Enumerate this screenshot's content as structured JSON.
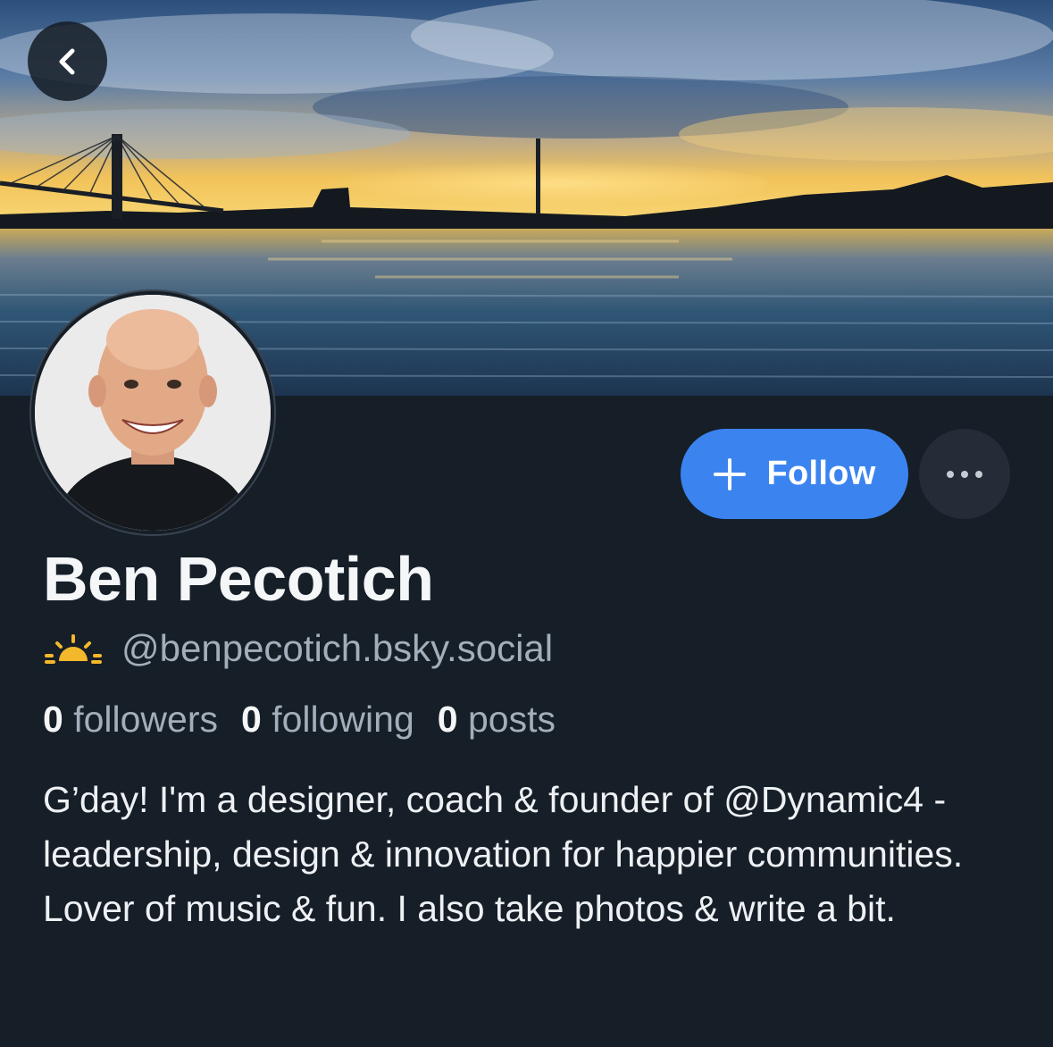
{
  "profile": {
    "display_name": "Ben Pecotich",
    "handle": "@benpecotich.bsky.social",
    "handle_emoji_icon": "sunrise-icon",
    "stats": [
      {
        "count": "0",
        "label": "followers"
      },
      {
        "count": "0",
        "label": "following"
      },
      {
        "count": "0",
        "label": "posts"
      }
    ],
    "bio": "G’day! I'm a designer, coach & founder of @Dynamic4 - leadership, design & innovation for happier communities. Lover of music & fun. I also take photos & write a bit."
  },
  "actions": {
    "follow_label": "Follow",
    "follow_icon": "plus-icon",
    "more_icon": "ellipsis-icon",
    "back_icon": "chevron-left-icon"
  },
  "colors": {
    "background": "#161e27",
    "accent": "#3b84f0",
    "secondary_text": "#a3aebb"
  }
}
